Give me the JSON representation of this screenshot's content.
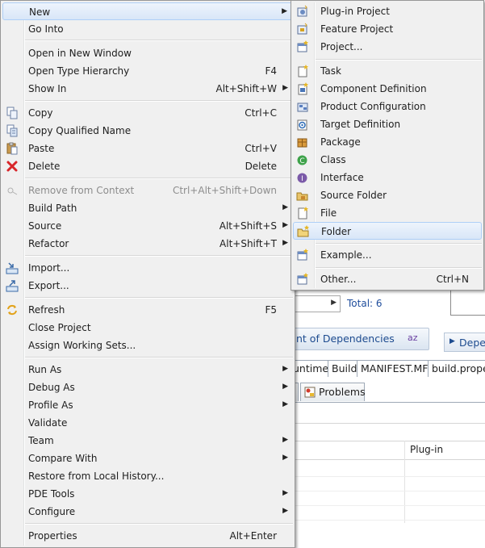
{
  "background": {
    "total_label": "Total: 6",
    "dependencies_button": "nt of Dependencies",
    "sort_icon_text": "az",
    "dependencies_right_button": "Depe",
    "editor_tabs": [
      "untime",
      "Build",
      "MANIFEST.MF",
      "build.prope"
    ],
    "view_tabs": [
      "Problems"
    ],
    "table_column": "Plug-in"
  },
  "main_menu": {
    "items": [
      {
        "label": "New",
        "submenu": true,
        "highlighted": true
      },
      {
        "label": "Go Into"
      },
      {
        "label": "Open in New Window"
      },
      {
        "label": "Open Type Hierarchy",
        "accel": "F4"
      },
      {
        "label": "Show In",
        "accel": "Alt+Shift+W",
        "submenu": true
      },
      {
        "label": "Copy",
        "accel": "Ctrl+C",
        "icon": "copy-icon"
      },
      {
        "label": "Copy Qualified Name",
        "icon": "copy-qualified-icon"
      },
      {
        "label": "Paste",
        "accel": "Ctrl+V",
        "icon": "paste-icon"
      },
      {
        "label": "Delete",
        "accel": "Delete",
        "icon": "delete-icon"
      },
      {
        "label": "Remove from Context",
        "accel": "Ctrl+Alt+Shift+Down",
        "disabled": true,
        "icon": "remove-context-icon"
      },
      {
        "label": "Build Path",
        "submenu": true
      },
      {
        "label": "Source",
        "accel": "Alt+Shift+S",
        "submenu": true
      },
      {
        "label": "Refactor",
        "accel": "Alt+Shift+T",
        "submenu": true
      },
      {
        "label": "Import...",
        "icon": "import-icon"
      },
      {
        "label": "Export...",
        "icon": "export-icon"
      },
      {
        "label": "Refresh",
        "accel": "F5",
        "icon": "refresh-icon"
      },
      {
        "label": "Close Project"
      },
      {
        "label": "Assign Working Sets..."
      },
      {
        "label": "Run As",
        "submenu": true
      },
      {
        "label": "Debug As",
        "submenu": true
      },
      {
        "label": "Profile As",
        "submenu": true
      },
      {
        "label": "Validate"
      },
      {
        "label": "Team",
        "submenu": true
      },
      {
        "label": "Compare With",
        "submenu": true
      },
      {
        "label": "Restore from Local History..."
      },
      {
        "label": "PDE Tools",
        "submenu": true
      },
      {
        "label": "Configure",
        "submenu": true
      },
      {
        "label": "Properties",
        "accel": "Alt+Enter"
      }
    ]
  },
  "new_submenu": {
    "items": [
      {
        "label": "Plug-in Project",
        "icon": "plugin-project-icon"
      },
      {
        "label": "Feature Project",
        "icon": "feature-project-icon"
      },
      {
        "label": "Project...",
        "icon": "project-icon"
      },
      {
        "label": "Task",
        "icon": "task-icon"
      },
      {
        "label": "Component Definition",
        "icon": "component-definition-icon"
      },
      {
        "label": "Product Configuration",
        "icon": "product-configuration-icon"
      },
      {
        "label": "Target Definition",
        "icon": "target-definition-icon"
      },
      {
        "label": "Package",
        "icon": "package-icon"
      },
      {
        "label": "Class",
        "icon": "class-icon"
      },
      {
        "label": "Interface",
        "icon": "interface-icon"
      },
      {
        "label": "Source Folder",
        "icon": "source-folder-icon"
      },
      {
        "label": "File",
        "icon": "file-icon"
      },
      {
        "label": "Folder",
        "icon": "folder-icon",
        "highlighted": true
      },
      {
        "label": "Example...",
        "icon": "example-icon"
      },
      {
        "label": "Other...",
        "accel": "Ctrl+N",
        "icon": "other-icon"
      }
    ]
  },
  "colors": {
    "menu_bg": "#f0f0f0",
    "highlight_border": "#aecff7",
    "link_blue": "#1f4d9c",
    "disabled_text": "#8d8d8d"
  }
}
